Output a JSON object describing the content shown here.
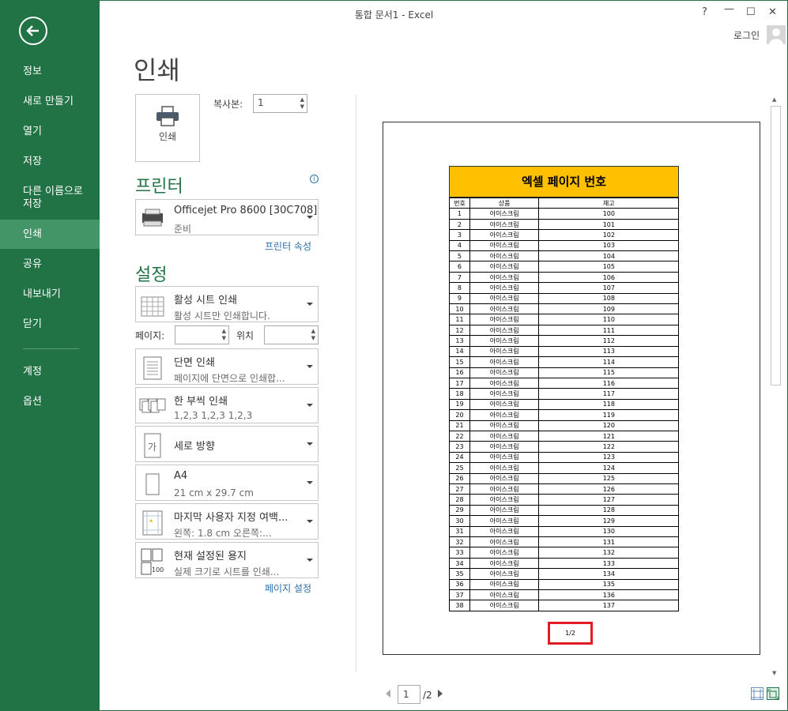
{
  "window": {
    "title": "통합 문서1 - Excel",
    "help": "?",
    "minimize": "—",
    "maximize": "☐",
    "close": "✕",
    "login": "로그인"
  },
  "sidebar": {
    "items": [
      {
        "label": "정보"
      },
      {
        "label": "새로 만들기"
      },
      {
        "label": "열기"
      },
      {
        "label": "저장"
      },
      {
        "label": "다른 이름으로\n저장",
        "line1": "다른 이름으로",
        "line2": "저장"
      },
      {
        "label": "인쇄"
      },
      {
        "label": "공유"
      },
      {
        "label": "내보내기"
      },
      {
        "label": "닫기"
      },
      {
        "label": "계정"
      },
      {
        "label": "옵션"
      }
    ]
  },
  "page": {
    "title": "인쇄"
  },
  "print": {
    "button_label": "인쇄",
    "copies_label": "복사본:",
    "copies_value": "1"
  },
  "printer": {
    "heading": "프린터",
    "info_icon": "i",
    "name": "Officejet Pro 8600 [30C708]",
    "status": "준비",
    "properties_link": "프린터 속성"
  },
  "settings": {
    "heading": "설정",
    "what": {
      "l1": "활성 시트 인쇄",
      "l2": "활성 시트만 인쇄합니다."
    },
    "pages_label": "페이지:",
    "pages_value": "",
    "to_label": "위치",
    "to_value": "",
    "sides": {
      "l1": "단면 인쇄",
      "l2": "페이지에 단면으로 인쇄합..."
    },
    "collate": {
      "l1": "한 부씩 인쇄",
      "l2": "1,2,3     1,2,3     1,2,3"
    },
    "orientation": {
      "l1": "세로 방향"
    },
    "paper": {
      "l1": "A4",
      "l2": "21 cm x 29.7 cm"
    },
    "margins": {
      "l1": "마지막 사용자 지정 여백...",
      "l2": "왼쪽:   1.8 cm     오른쪽:..."
    },
    "scaling": {
      "l1": "현재 설정된 용지",
      "l2": "실제 크기로 시트를 인쇄...",
      "icon_text": "100"
    },
    "page_setup_link": "페이지 설정"
  },
  "preview": {
    "sheet_title": "엑셀 페이지 번호",
    "headers": [
      "번호",
      "상품",
      "재고"
    ],
    "rows": [
      [
        "1",
        "아이스크림",
        "100"
      ],
      [
        "2",
        "아이스크림",
        "101"
      ],
      [
        "3",
        "아이스크림",
        "102"
      ],
      [
        "4",
        "아이스크림",
        "103"
      ],
      [
        "5",
        "아이스크림",
        "104"
      ],
      [
        "6",
        "아이스크림",
        "105"
      ],
      [
        "7",
        "아이스크림",
        "106"
      ],
      [
        "8",
        "아이스크림",
        "107"
      ],
      [
        "9",
        "아이스크림",
        "108"
      ],
      [
        "10",
        "아이스크림",
        "109"
      ],
      [
        "11",
        "아이스크림",
        "110"
      ],
      [
        "12",
        "아이스크림",
        "111"
      ],
      [
        "13",
        "아이스크림",
        "112"
      ],
      [
        "14",
        "아이스크림",
        "113"
      ],
      [
        "15",
        "아이스크림",
        "114"
      ],
      [
        "16",
        "아이스크림",
        "115"
      ],
      [
        "17",
        "아이스크림",
        "116"
      ],
      [
        "18",
        "아이스크림",
        "117"
      ],
      [
        "19",
        "아이스크림",
        "118"
      ],
      [
        "20",
        "아이스크림",
        "119"
      ],
      [
        "21",
        "아이스크림",
        "120"
      ],
      [
        "22",
        "아이스크림",
        "121"
      ],
      [
        "23",
        "아이스크림",
        "122"
      ],
      [
        "24",
        "아이스크림",
        "123"
      ],
      [
        "25",
        "아이스크림",
        "124"
      ],
      [
        "26",
        "아이스크림",
        "125"
      ],
      [
        "27",
        "아이스크림",
        "126"
      ],
      [
        "28",
        "아이스크림",
        "127"
      ],
      [
        "29",
        "아이스크림",
        "128"
      ],
      [
        "30",
        "아이스크림",
        "129"
      ],
      [
        "31",
        "아이스크림",
        "130"
      ],
      [
        "32",
        "아이스크림",
        "131"
      ],
      [
        "33",
        "아이스크림",
        "132"
      ],
      [
        "34",
        "아이스크림",
        "133"
      ],
      [
        "35",
        "아이스크림",
        "134"
      ],
      [
        "36",
        "아이스크림",
        "135"
      ],
      [
        "37",
        "아이스크림",
        "136"
      ],
      [
        "38",
        "아이스크림",
        "137"
      ]
    ],
    "page_footer": "1/2",
    "current_page": "1",
    "total_pages": "/2",
    "highlight_color": "#e21b24",
    "header_fill": "#ffc000"
  },
  "colors": {
    "accent": "#217346",
    "link": "#2a6fa8"
  }
}
